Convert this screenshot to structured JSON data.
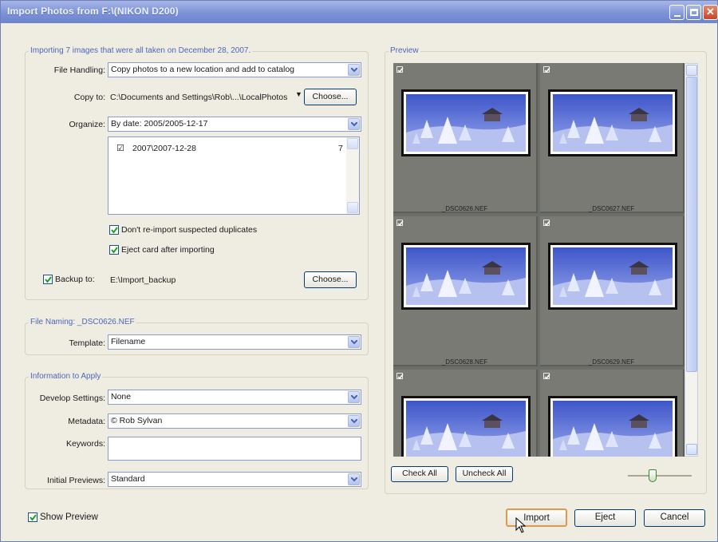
{
  "window": {
    "title": "Import Photos from F:\\(NIKON D200)"
  },
  "importing": {
    "legend": "Importing 7 images that were all taken on December 28, 2007.",
    "file_handling_label": "File Handling:",
    "file_handling_value": "Copy photos to a new location and add to catalog",
    "copy_to_label": "Copy to:",
    "copy_to_value": "C:\\Documents and Settings\\Rob\\...\\LocalPhotos",
    "choose_label": "Choose...",
    "organize_label": "Organize:",
    "organize_value": "By date: 2005/2005-12-17",
    "folders": [
      {
        "name": "2007\\2007-12-28",
        "count": "7"
      }
    ],
    "dont_reimport_label": "Don't re-import suspected duplicates",
    "eject_card_label": "Eject card after importing",
    "backup_label": "Backup to:",
    "backup_value": "E:\\Import_backup",
    "backup_choose_label": "Choose..."
  },
  "file_naming": {
    "legend": "File Naming:  _DSC0626.NEF",
    "template_label": "Template:",
    "template_value": "Filename"
  },
  "info": {
    "legend": "Information to Apply",
    "develop_label": "Develop Settings:",
    "develop_value": "None",
    "metadata_label": "Metadata:",
    "metadata_value": "© Rob Sylvan",
    "keywords_label": "Keywords:",
    "keywords_value": "",
    "initial_previews_label": "Initial Previews:",
    "initial_previews_value": "Standard"
  },
  "preview": {
    "legend": "Preview",
    "thumbnails": [
      "_DSC0626.NEF",
      "_DSC0627.NEF",
      "_DSC0628.NEF",
      "_DSC0629.NEF",
      "",
      ""
    ],
    "check_all_label": "Check All",
    "uncheck_all_label": "Uncheck All"
  },
  "footer": {
    "show_preview_label": "Show Preview",
    "import_label": "Import",
    "eject_label": "Eject",
    "cancel_label": "Cancel"
  },
  "colors": {
    "title_bar": "#7c92d8",
    "legend_text": "#4c67b8",
    "preview_bg": "#6b6e68"
  }
}
